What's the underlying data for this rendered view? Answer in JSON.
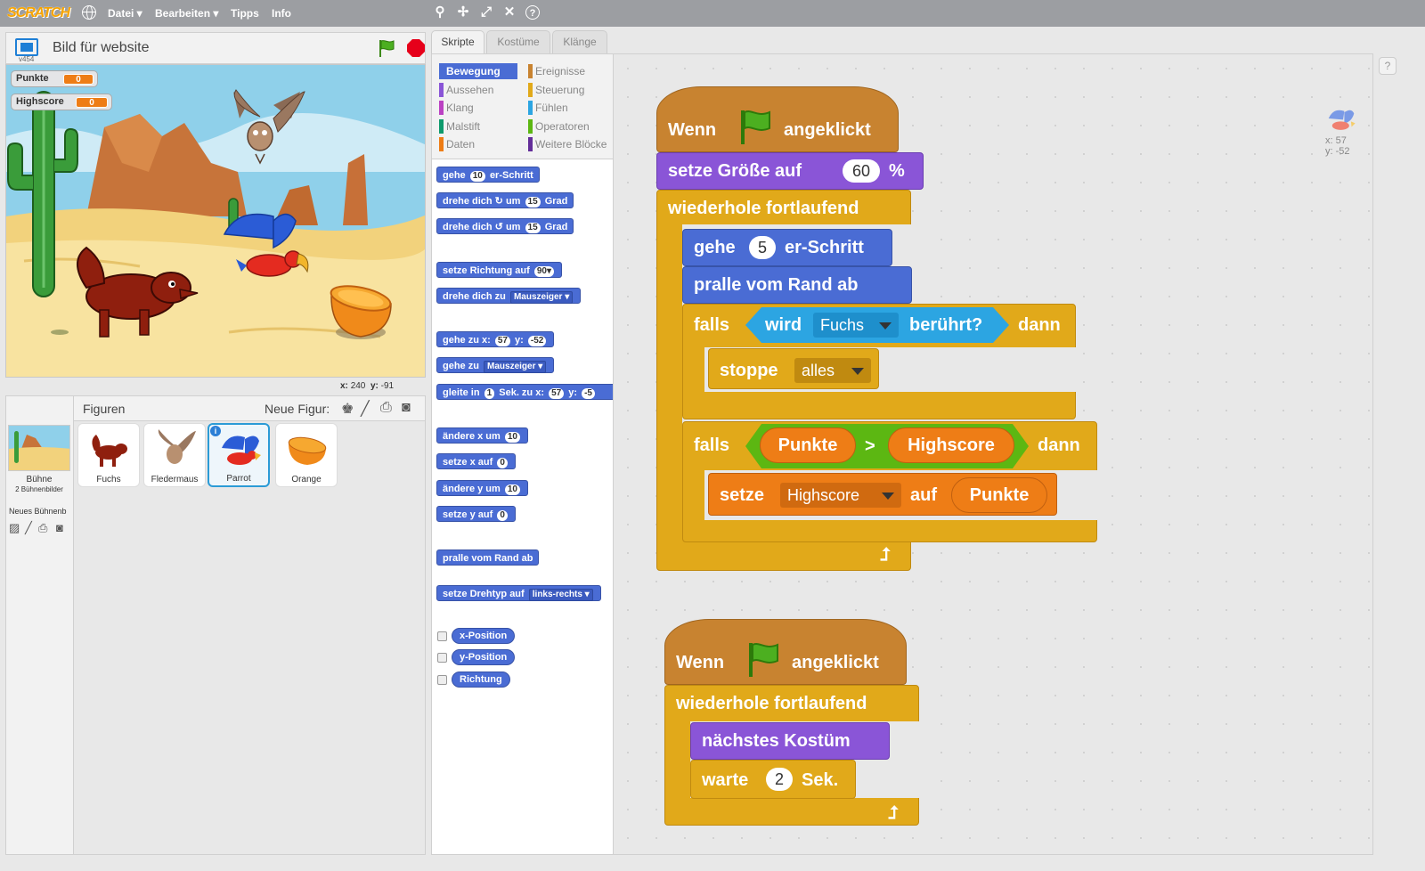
{
  "menubar": {
    "logo": "SCRATCH",
    "items": [
      {
        "label": "Datei ▾"
      },
      {
        "label": "Bearbeiten ▾"
      },
      {
        "label": "Tipps"
      },
      {
        "label": "Info"
      }
    ],
    "tool_icons": [
      "duplicate-icon",
      "cut-icon",
      "grow-icon",
      "shrink-icon",
      "help-icon"
    ]
  },
  "stage": {
    "title": "Bild für website",
    "version": "v454",
    "monitors": [
      {
        "label": "Punkte",
        "value": "0"
      },
      {
        "label": "Highscore",
        "value": "0"
      }
    ],
    "coords": {
      "x_label": "x:",
      "x": "240",
      "y_label": "y:",
      "y": "-91"
    }
  },
  "sprites_panel": {
    "header": "Figuren",
    "new_sprite": "Neue Figur:",
    "stage_label": "Bühne",
    "stage_sub": "2 Bühnenbilder",
    "new_backdrop": "Neues Bühnenb",
    "sprites": [
      {
        "name": "Fuchs",
        "selected": false
      },
      {
        "name": "Fledermaus",
        "selected": false
      },
      {
        "name": "Parrot",
        "selected": true
      },
      {
        "name": "Orange",
        "selected": false
      }
    ]
  },
  "tabs": [
    {
      "label": "Skripte",
      "active": true
    },
    {
      "label": "Kostüme",
      "active": false
    },
    {
      "label": "Klänge",
      "active": false
    }
  ],
  "categories": [
    {
      "label": "Bewegung",
      "color": "#4a6cd4",
      "active": true
    },
    {
      "label": "Aussehen",
      "color": "#8a55d7",
      "active": false
    },
    {
      "label": "Klang",
      "color": "#bb42c3",
      "active": false
    },
    {
      "label": "Malstift",
      "color": "#0e9a6c",
      "active": false
    },
    {
      "label": "Daten",
      "color": "#ee7d16",
      "active": false
    },
    {
      "label": "Ereignisse",
      "color": "#c88330",
      "active": false
    },
    {
      "label": "Steuerung",
      "color": "#e1a91a",
      "active": false
    },
    {
      "label": "Fühlen",
      "color": "#2ca5e2",
      "active": false
    },
    {
      "label": "Operatoren",
      "color": "#5cb712",
      "active": false
    },
    {
      "label": "Weitere Blöcke",
      "color": "#632d99",
      "active": false
    }
  ],
  "palette": {
    "gehe": "gehe",
    "gehe_val": "10",
    "gehe_suffix": "er-Schritt",
    "drehe_r": "drehe dich ↻ um",
    "drehe_r_val": "15",
    "grad": "Grad",
    "drehe_l": "drehe dich ↺ um",
    "drehe_l_val": "15",
    "richtung": "setze Richtung auf",
    "richtung_val": "90▾",
    "drehe_zu": "drehe dich zu",
    "mauszeiger": "Mauszeiger ▾",
    "gehe_zu_x": "gehe zu x:",
    "x_val": "57",
    "y_lbl": "y:",
    "y_val": "-52",
    "gehe_zu": "gehe zu",
    "gleite": "gleite in",
    "gleite_val": "1",
    "gleite_mid": "Sek. zu x:",
    "gleite_x": "57",
    "gleite_y_lbl": "y:",
    "gleite_y": "-5",
    "aendere_x": "ändere x um",
    "aendere_x_val": "10",
    "setze_x": "setze x auf",
    "setze_x_val": "0",
    "aendere_y": "ändere y um",
    "aendere_y_val": "10",
    "setze_y": "setze y auf",
    "setze_y_val": "0",
    "pralle": "pralle vom Rand ab",
    "drehtyp": "setze Drehtyp auf",
    "drehtyp_val": "links-rechts ▾",
    "reporters": [
      "x-Position",
      "y-Position",
      "Richtung"
    ]
  },
  "sprite_info": {
    "x": "x: 57",
    "y": "y: -52"
  },
  "script1": {
    "hat_a": "Wenn",
    "hat_b": "angeklickt",
    "size_a": "setze Größe auf",
    "size_val": "60",
    "size_b": "%",
    "forever": "wiederhole fortlaufend",
    "move_a": "gehe",
    "move_val": "5",
    "move_b": "er-Schritt",
    "bounce": "pralle vom Rand ab",
    "if1": "falls",
    "touch_a": "wird",
    "touch_val": "Fuchs",
    "touch_b": "berührt?",
    "then1": "dann",
    "stop": "stoppe",
    "stop_val": "alles",
    "if2": "falls",
    "cmp_left": "Punkte",
    "cmp_op": ">",
    "cmp_right": "Highscore",
    "then2": "dann",
    "set_a": "setze",
    "set_var": "Highscore",
    "set_b": "auf",
    "set_val": "Punkte"
  },
  "script2": {
    "hat_a": "Wenn",
    "hat_b": "angeklickt",
    "forever": "wiederhole fortlaufend",
    "costume": "nächstes Kostüm",
    "wait_a": "warte",
    "wait_val": "2",
    "wait_b": "Sek."
  }
}
